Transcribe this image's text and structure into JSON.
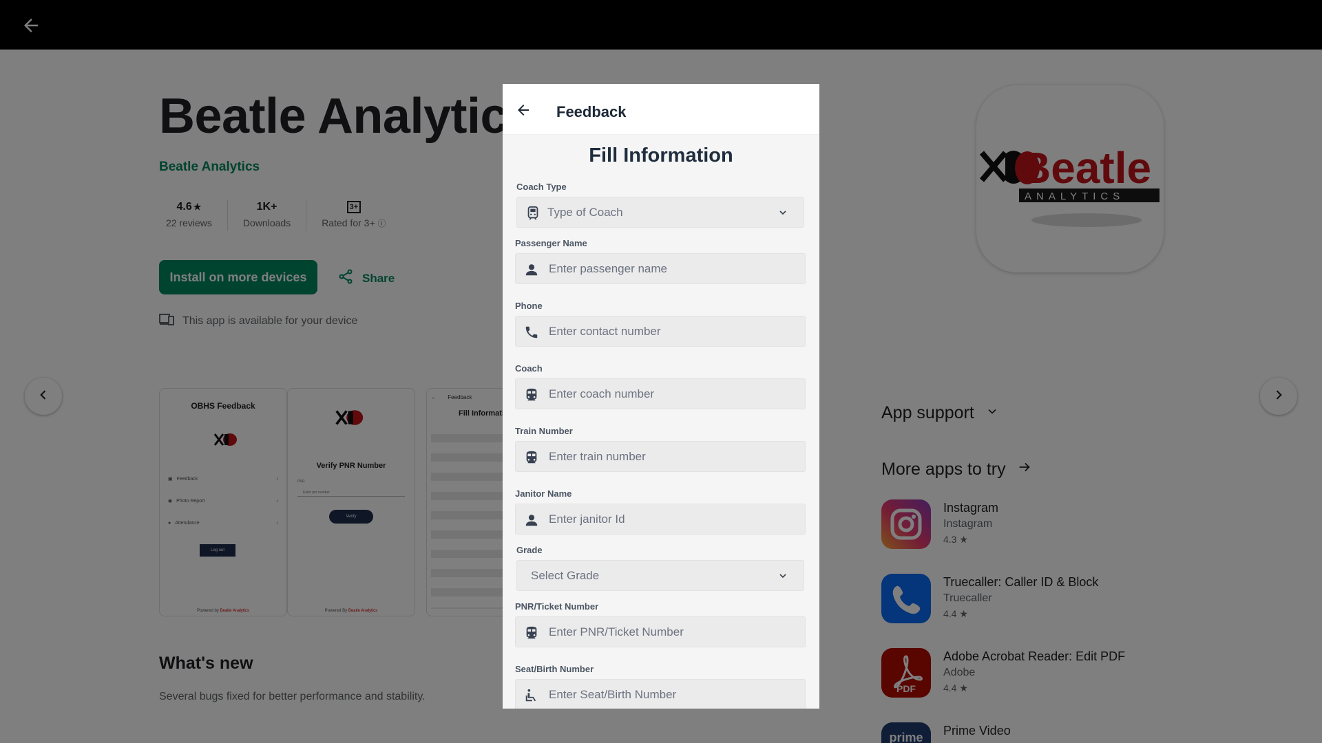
{
  "topbar": {
    "back_icon": "arrow-left-icon"
  },
  "app": {
    "title": "Beatle Analytics",
    "developer": "Beatle Analytics",
    "rating_value": "4.6",
    "rating_label": "22 reviews",
    "downloads_value": "1K+",
    "downloads_label": "Downloads",
    "age_badge": "3+",
    "age_label": "Rated for 3+",
    "install_label": "Install on more devices",
    "share_label": "Share",
    "device_note": "This app is available for your device",
    "whats_new_title": "What's new",
    "whats_new_text": "Several bugs fixed for better performance and stability.",
    "brand_color": "#01875f"
  },
  "screenshots": {
    "shot1": {
      "title": "OBHS Feedback",
      "items": [
        "Feedback",
        "Photo Report",
        "Attendance"
      ],
      "button": "Log out",
      "footer_prefix": "Powered by",
      "footer_brand": "Beatle Analytics"
    },
    "shot2": {
      "title": "Verify PNR Number",
      "field_label": "PNR",
      "placeholder": "Enter pnr number",
      "button": "Verify",
      "footer_prefix": "Powered By",
      "footer_brand": "Beatle Analytics"
    },
    "shot3": {
      "header": "Feedback",
      "title": "Fill Informati"
    }
  },
  "sidebar": {
    "app_support": "App support",
    "more_apps": "More apps to try",
    "apps": [
      {
        "name": "Instagram",
        "developer": "Instagram",
        "rating": "4.3 ★"
      },
      {
        "name": "Truecaller: Caller ID & Block",
        "developer": "Truecaller",
        "rating": "4.4 ★"
      },
      {
        "name": "Adobe Acrobat Reader: Edit PDF",
        "developer": "Adobe",
        "rating": "4.4 ★"
      },
      {
        "name": "Prime Video",
        "icon_text": "prime"
      }
    ],
    "logo_word": "Beatle",
    "logo_sub": "ANALYTICS",
    "pdf_label": "PDF"
  },
  "dialog": {
    "header_title": "Feedback",
    "form_title": "Fill Information",
    "fields": [
      {
        "label": "Coach Type",
        "placeholder": "Type of Coach",
        "icon": "train-icon",
        "type": "select"
      },
      {
        "label": "Passenger Name",
        "placeholder": "Enter passenger name",
        "icon": "person-icon",
        "type": "text"
      },
      {
        "label": "Phone",
        "placeholder": "Enter contact number",
        "icon": "phone-icon",
        "type": "text"
      },
      {
        "label": "Coach",
        "placeholder": "Enter coach number",
        "icon": "train-icon",
        "type": "text"
      },
      {
        "label": "Train Number",
        "placeholder": "Enter train number",
        "icon": "train-icon",
        "type": "text"
      },
      {
        "label": "Janitor Name",
        "placeholder": "Enter janitor Id",
        "icon": "person-icon",
        "type": "text"
      },
      {
        "label": "Grade",
        "placeholder": "Select Grade",
        "icon": "chevron-down-icon",
        "type": "select"
      },
      {
        "label": "PNR/Ticket Number",
        "placeholder": "Enter PNR/Ticket Number",
        "icon": "train-icon",
        "type": "text"
      },
      {
        "label": "Seat/Birth Number",
        "placeholder": "Enter Seat/Birth Number",
        "icon": "seat-icon",
        "type": "text"
      }
    ]
  }
}
